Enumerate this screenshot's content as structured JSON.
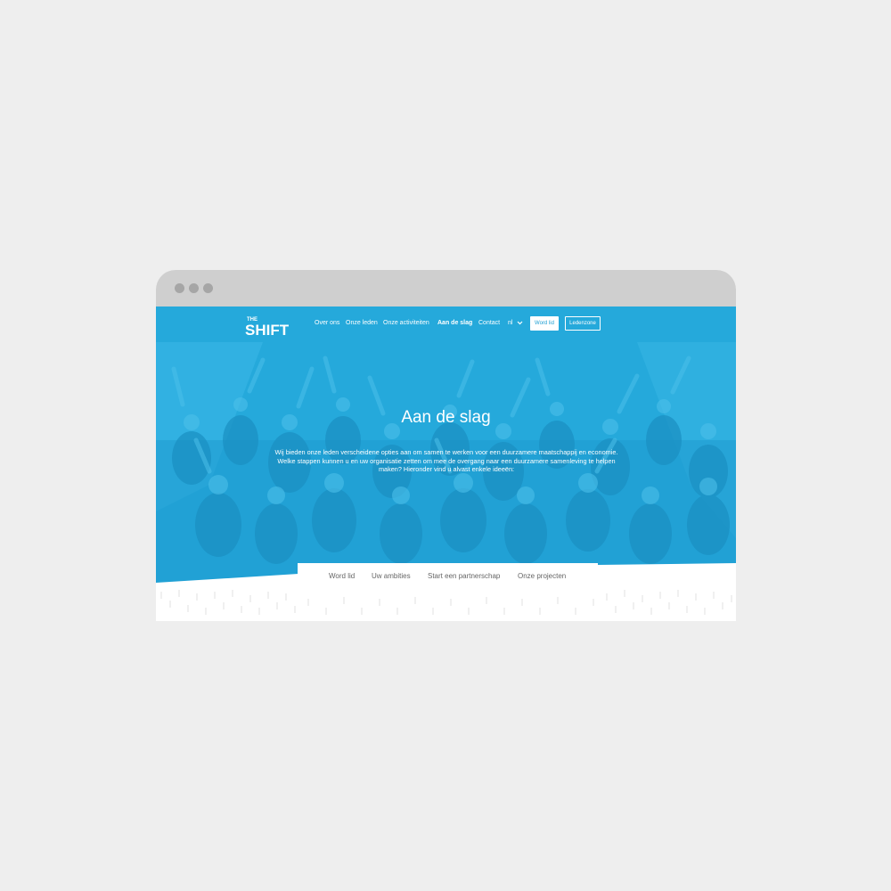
{
  "nav": {
    "logo_top": "THE",
    "logo_main": "SHIFT",
    "links": [
      {
        "label": "Over ons",
        "active": false
      },
      {
        "label": "Onze leden",
        "active": false
      },
      {
        "label": "Onze activiteiten",
        "active": false
      },
      {
        "label": "Aan de slag",
        "active": true
      },
      {
        "label": "Contact",
        "active": false
      }
    ],
    "language": "nl",
    "word_lid_button": "Word lid",
    "ledenzone_button": "Ledenzone"
  },
  "hero": {
    "title": "Aan de slag",
    "intro_line1": "Wij bieden onze leden verscheidene opties aan om samen te werken voor een duurzamere maatschappij en economie.",
    "intro_line2": "Welke stappen kunnen u en uw organisatie zetten om mee de overgang naar een duurzamere samenleving te helpen",
    "intro_line3": "maken? Hieronder vind u alvast enkele ideeën:"
  },
  "tabs": [
    {
      "label": "Word lid"
    },
    {
      "label": "Uw ambities"
    },
    {
      "label": "Start een partnerschap"
    },
    {
      "label": "Onze projecten"
    }
  ],
  "colors": {
    "brand_blue": "#26afe0",
    "page_bg": "#eeeeee",
    "chrome": "#cfcfcf"
  }
}
